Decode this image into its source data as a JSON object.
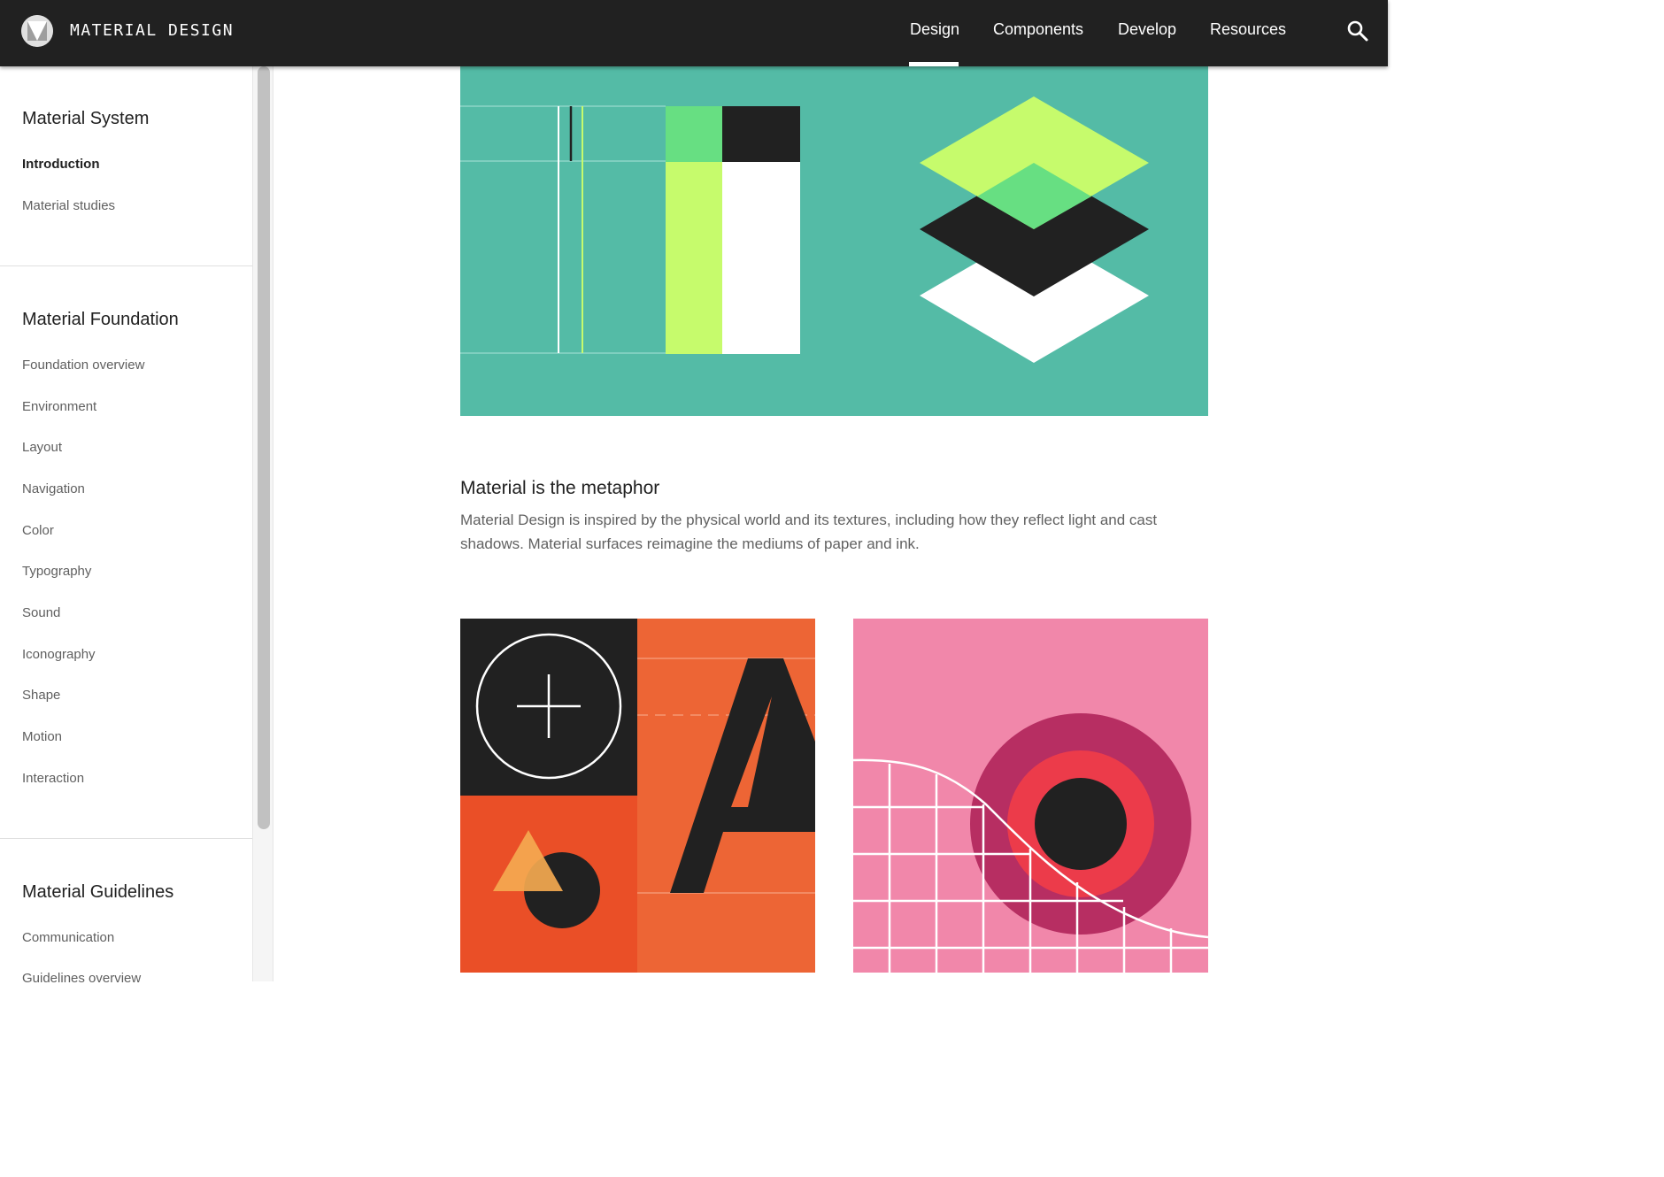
{
  "header": {
    "title": "MATERIAL DESIGN",
    "logo_icon": "material-logo-icon",
    "nav": [
      {
        "label": "Design",
        "active": true
      },
      {
        "label": "Components",
        "active": false
      },
      {
        "label": "Develop",
        "active": false
      },
      {
        "label": "Resources",
        "active": false
      }
    ],
    "search_icon": "search-icon"
  },
  "sidebar": {
    "sections": [
      {
        "title": "Material System",
        "items": [
          "Introduction",
          "Material studies"
        ],
        "active_item": "Introduction"
      },
      {
        "title": "Material Foundation",
        "items": [
          "Foundation overview",
          "Environment",
          "Layout",
          "Navigation",
          "Color",
          "Typography",
          "Sound",
          "Iconography",
          "Shape",
          "Motion",
          "Interaction"
        ]
      },
      {
        "title": "Material Guidelines",
        "items": [
          "Communication",
          "Guidelines overview"
        ]
      }
    ]
  },
  "main": {
    "heading": "Material is the metaphor",
    "body": "Material Design is inspired by the physical world and its textures, including how they reflect light and cast shadows. Material surfaces reimagine the mediums of paper and ink."
  },
  "colors": {
    "topbar": "#212121",
    "hero_teal": "#54bba6",
    "lime": "#c6fb6c",
    "green": "#67df82",
    "orange": "#ed6535",
    "orange_red": "#ea4f27",
    "pink": "#f187aa",
    "magenta": "#b72e62",
    "red": "#ec3b4a"
  }
}
